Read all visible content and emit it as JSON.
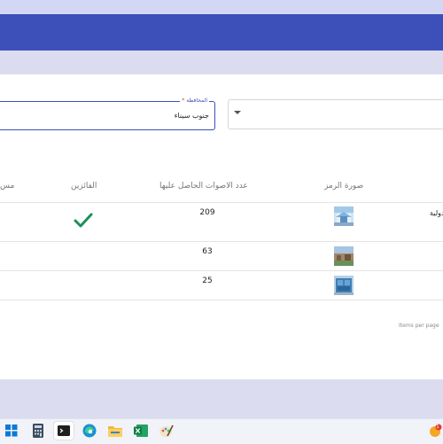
{
  "filters": {
    "governorate_label": "المحافظة",
    "governorate_required_mark": "*",
    "governorate_value": "جنوب سيناء"
  },
  "table": {
    "headers": {
      "col_cut": "مس",
      "winners": "الفائزين",
      "votes": "عدد الاصوات الحاصل عليها",
      "symbol_image": "صورة الرمز"
    },
    "rows": [
      {
        "name": "دولية",
        "votes": "209",
        "winner": true
      },
      {
        "name": "",
        "votes": "63",
        "winner": false
      },
      {
        "name": "",
        "votes": "25",
        "winner": false
      }
    ]
  },
  "paginator": {
    "items_per_page": "Items per page"
  },
  "taskbar": {
    "notification_count": "1",
    "apps": [
      "start",
      "calculator",
      "terminal",
      "edge",
      "file-explorer",
      "excel",
      "paint"
    ]
  },
  "colors": {
    "primary": "#3d4fb8",
    "check": "#1e8f5a",
    "page_bg": "#dcdcf0"
  }
}
